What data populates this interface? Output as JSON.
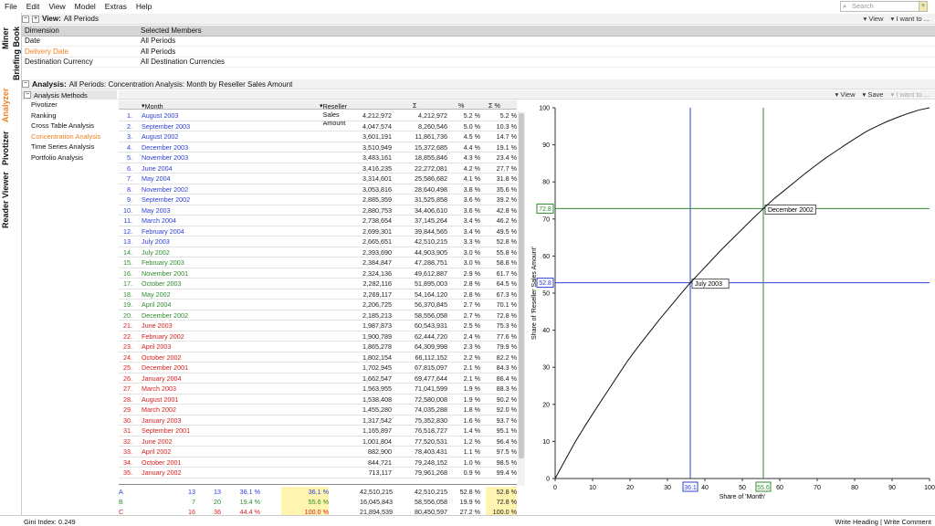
{
  "menu": [
    "File",
    "Edit",
    "View",
    "Model",
    "Extras",
    "Help"
  ],
  "search_placeholder": "Search",
  "side_tabs": [
    "Miner",
    "Briefing Book",
    "Analyzer",
    "Pivotizer",
    "Viewer",
    "Reader"
  ],
  "view_bar": {
    "label": "View:",
    "value": "All Periods",
    "view_btn": "View",
    "iwant_btn": "I want to ..."
  },
  "dimensions": {
    "col1": "Dimension",
    "col2": "Selected Members",
    "rows": [
      [
        "Date",
        "All Periods"
      ],
      [
        "Delivery Date",
        "All Periods"
      ],
      [
        "Destination Currency",
        "All Destination Currencies"
      ]
    ]
  },
  "analysis_bar": {
    "label": "Analysis:",
    "value": "All Periods: Concentration Analysis: Month by Reseller Sales Amount",
    "view_btn": "View",
    "save_btn": "Save",
    "iwant_btn": "I want to ..."
  },
  "methods": {
    "title": "Analysis Methods",
    "items": [
      "Pivotizer",
      "Ranking",
      "Cross Table Analysis",
      "Concentration Analysis",
      "Time Series Analysis",
      "Portfolio Analysis"
    ]
  },
  "grid": {
    "headers": [
      "Month",
      "Reseller Sales Amount",
      "Σ",
      "%",
      "Σ %"
    ],
    "rows": [
      [
        "1.",
        "August 2003",
        "4,212,972",
        "4,212,972",
        "5.2 %",
        "5.2 %",
        "A"
      ],
      [
        "2.",
        "September 2003",
        "4,047,574",
        "8,260,546",
        "5.0 %",
        "10.3 %",
        "A"
      ],
      [
        "3.",
        "August 2002",
        "3,601,191",
        "11,861,736",
        "4.5 %",
        "14.7 %",
        "A"
      ],
      [
        "4.",
        "December 2003",
        "3,510,949",
        "15,372,685",
        "4.4 %",
        "19.1 %",
        "A"
      ],
      [
        "5.",
        "November 2003",
        "3,483,161",
        "18,855,846",
        "4.3 %",
        "23.4 %",
        "A"
      ],
      [
        "6.",
        "June 2004",
        "3,416,235",
        "22,272,081",
        "4.2 %",
        "27.7 %",
        "A"
      ],
      [
        "7.",
        "May 2004",
        "3,314,601",
        "25,586,682",
        "4.1 %",
        "31.8 %",
        "A"
      ],
      [
        "8.",
        "November 2002",
        "3,053,816",
        "28,640,498",
        "3.8 %",
        "35.6 %",
        "A"
      ],
      [
        "9.",
        "September 2002",
        "2,885,359",
        "31,525,858",
        "3.6 %",
        "39.2 %",
        "A"
      ],
      [
        "10.",
        "May 2003",
        "2,880,753",
        "34,406,610",
        "3.6 %",
        "42.8 %",
        "A"
      ],
      [
        "11.",
        "March 2004",
        "2,738,654",
        "37,145,264",
        "3.4 %",
        "46.2 %",
        "A"
      ],
      [
        "12.",
        "February 2004",
        "2,699,301",
        "39,844,565",
        "3.4 %",
        "49.5 %",
        "A"
      ],
      [
        "13.",
        "July 2003",
        "2,665,651",
        "42,510,215",
        "3.3 %",
        "52.8 %",
        "A"
      ],
      [
        "14.",
        "July 2002",
        "2,393,690",
        "44,903,905",
        "3.0 %",
        "55.8 %",
        "B"
      ],
      [
        "15.",
        "February 2003",
        "2,384,847",
        "47,288,751",
        "3.0 %",
        "58.8 %",
        "B"
      ],
      [
        "16.",
        "November 2001",
        "2,324,136",
        "49,612,887",
        "2.9 %",
        "61.7 %",
        "B"
      ],
      [
        "17.",
        "October 2003",
        "2,282,116",
        "51,895,003",
        "2.8 %",
        "64.5 %",
        "B"
      ],
      [
        "18.",
        "May 2002",
        "2,269,117",
        "54,164,120",
        "2.8 %",
        "67.3 %",
        "B"
      ],
      [
        "19.",
        "April 2004",
        "2,206,725",
        "56,370,845",
        "2.7 %",
        "70.1 %",
        "B"
      ],
      [
        "20.",
        "December 2002",
        "2,185,213",
        "58,556,058",
        "2.7 %",
        "72.8 %",
        "B"
      ],
      [
        "21.",
        "June 2003",
        "1,987,873",
        "60,543,931",
        "2.5 %",
        "75.3 %",
        "C"
      ],
      [
        "22.",
        "February 2002",
        "1,900,789",
        "62,444,720",
        "2.4 %",
        "77.6 %",
        "C"
      ],
      [
        "23.",
        "April 2003",
        "1,865,278",
        "64,309,998",
        "2.3 %",
        "79.9 %",
        "C"
      ],
      [
        "24.",
        "October 2002",
        "1,802,154",
        "66,112,152",
        "2.2 %",
        "82.2 %",
        "C"
      ],
      [
        "25.",
        "December 2001",
        "1,702,945",
        "67,815,097",
        "2.1 %",
        "84.3 %",
        "C"
      ],
      [
        "26.",
        "January 2004",
        "1,662,547",
        "69,477,644",
        "2.1 %",
        "86.4 %",
        "C"
      ],
      [
        "27.",
        "March 2003",
        "1,563,955",
        "71,041,599",
        "1.9 %",
        "88.3 %",
        "C"
      ],
      [
        "28.",
        "August 2001",
        "1,538,408",
        "72,580,008",
        "1.9 %",
        "90.2 %",
        "C"
      ],
      [
        "29.",
        "March 2002",
        "1,455,280",
        "74,035,288",
        "1.8 %",
        "92.0 %",
        "C"
      ],
      [
        "30.",
        "January 2003",
        "1,317,542",
        "75,352,830",
        "1.6 %",
        "93.7 %",
        "C"
      ],
      [
        "31.",
        "September 2001",
        "1,165,897",
        "76,518,727",
        "1.4 %",
        "95.1 %",
        "C"
      ],
      [
        "32.",
        "June 2002",
        "1,001,804",
        "77,520,531",
        "1.2 %",
        "96.4 %",
        "C"
      ],
      [
        "33.",
        "April 2002",
        "882,900",
        "78,403,431",
        "1.1 %",
        "97.5 %",
        "C"
      ],
      [
        "34.",
        "October 2001",
        "844,721",
        "79,248,152",
        "1.0 %",
        "98.5 %",
        "C"
      ],
      [
        "35.",
        "January 2002",
        "713,117",
        "79,961,268",
        "0.9 %",
        "99.4 %",
        "C"
      ]
    ]
  },
  "summary": [
    [
      "A",
      "13",
      "13",
      "36.1 %",
      "36.1 %",
      "42,510,215",
      "42,510,215",
      "52.8 %",
      "52.8 %"
    ],
    [
      "B",
      "7",
      "20",
      "19.4 %",
      "55.6 %",
      "16,045,843",
      "58,556,058",
      "19.9 %",
      "72.8 %"
    ],
    [
      "C",
      "16",
      "36",
      "44.4 %",
      "100.0 %",
      "21,894,539",
      "80,450,597",
      "27.2 %",
      "100.0 %"
    ]
  ],
  "status": {
    "left": "Gini Index: 0.249",
    "right": "Write Heading | Write Comment"
  },
  "colors": {
    "A": "#2b3fd6",
    "B": "#2e8b2e",
    "C": "#d81e1e",
    "accent": "#f08020"
  },
  "chart_data": {
    "type": "line",
    "xlabel": "Share of 'Month'",
    "ylabel": "Share of 'Reseller Sales Amount'",
    "xlim": [
      0,
      100
    ],
    "ylim": [
      0,
      100
    ],
    "ticks": [
      0,
      10,
      20,
      30,
      40,
      50,
      60,
      70,
      80,
      90,
      100
    ],
    "series": [
      {
        "x": [
          0,
          2.8,
          5.6,
          8.3,
          11.1,
          13.9,
          16.7,
          19.4,
          22.2,
          25,
          27.8,
          30.6,
          33.3,
          36.1,
          38.9,
          41.7,
          44.4,
          47.2,
          50,
          52.8,
          55.6,
          58.3,
          61.1,
          63.9,
          66.7,
          69.4,
          72.2,
          75,
          77.8,
          80.6,
          83.3,
          86.1,
          88.9,
          91.7,
          94.4,
          97.2,
          100
        ],
        "y": [
          0,
          5.2,
          10.3,
          14.7,
          19.1,
          23.4,
          27.7,
          31.8,
          35.6,
          39.2,
          42.8,
          46.2,
          49.5,
          52.8,
          55.8,
          58.8,
          61.7,
          64.5,
          67.3,
          70.1,
          72.8,
          75.3,
          77.6,
          79.9,
          82.2,
          84.3,
          86.4,
          88.3,
          90.2,
          92.0,
          93.7,
          95.1,
          96.4,
          97.5,
          98.5,
          99.4,
          100
        ]
      }
    ],
    "markers": [
      {
        "x": 36.1,
        "y": 52.8,
        "label": "July 2003",
        "xtag": "36.1",
        "ytag": "52.8",
        "color": "#2b3fd6"
      },
      {
        "x": 55.6,
        "y": 72.8,
        "label": "December 2002",
        "xtag": "55.6",
        "ytag": "72.8",
        "color": "#2e8b2e"
      }
    ]
  }
}
